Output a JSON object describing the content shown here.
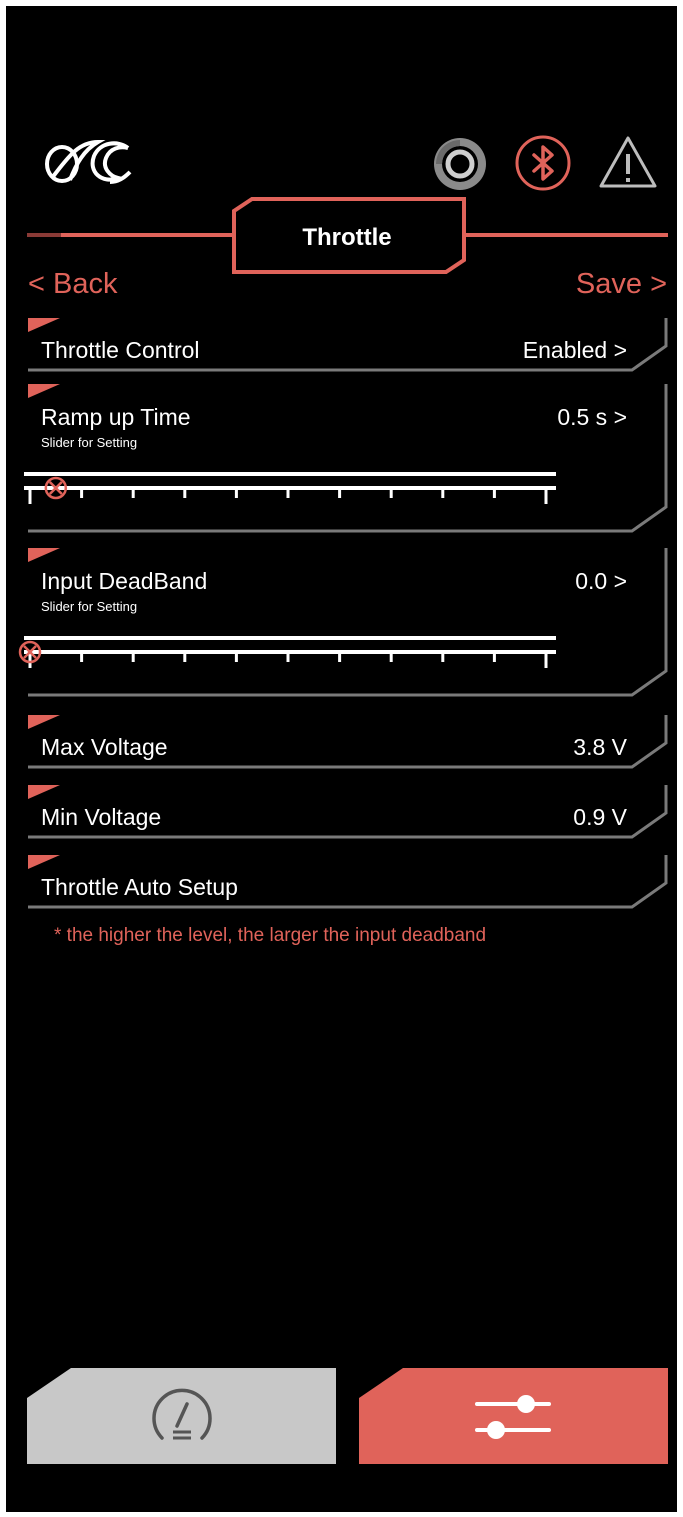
{
  "header": {
    "title": "Throttle",
    "back_label": "< Back",
    "save_label": "Save >"
  },
  "status_icons": [
    "logo-icon",
    "brake-disc-icon",
    "bluetooth-icon",
    "warning-icon"
  ],
  "rows": {
    "throttle_control": {
      "label": "Throttle Control",
      "value": "Enabled >"
    },
    "ramp_up_time": {
      "label": "Ramp up Time",
      "value": "0.5 s >",
      "subtitle": "Slider for Setting",
      "slider_level": 0.05
    },
    "input_deadband": {
      "label": "Input DeadBand",
      "value": "0.0 >",
      "subtitle": "Slider for Setting",
      "slider_level": 0.0
    },
    "max_voltage": {
      "label": "Max Voltage",
      "value": "3.8 V"
    },
    "min_voltage": {
      "label": "Min Voltage",
      "value": "0.9 V"
    },
    "auto_setup": {
      "label": "Throttle Auto Setup"
    }
  },
  "note": "* the higher the level, the larger the input deadband",
  "bottom_tabs": [
    {
      "name": "dashboard",
      "icon": "gauge-icon",
      "active": false
    },
    {
      "name": "settings",
      "icon": "sliders-icon",
      "active": true
    }
  ],
  "colors": {
    "accent": "#e0635a",
    "background": "#000000",
    "inactive_tab": "#c8c8c8",
    "frame_line": "#7a7a7a"
  }
}
